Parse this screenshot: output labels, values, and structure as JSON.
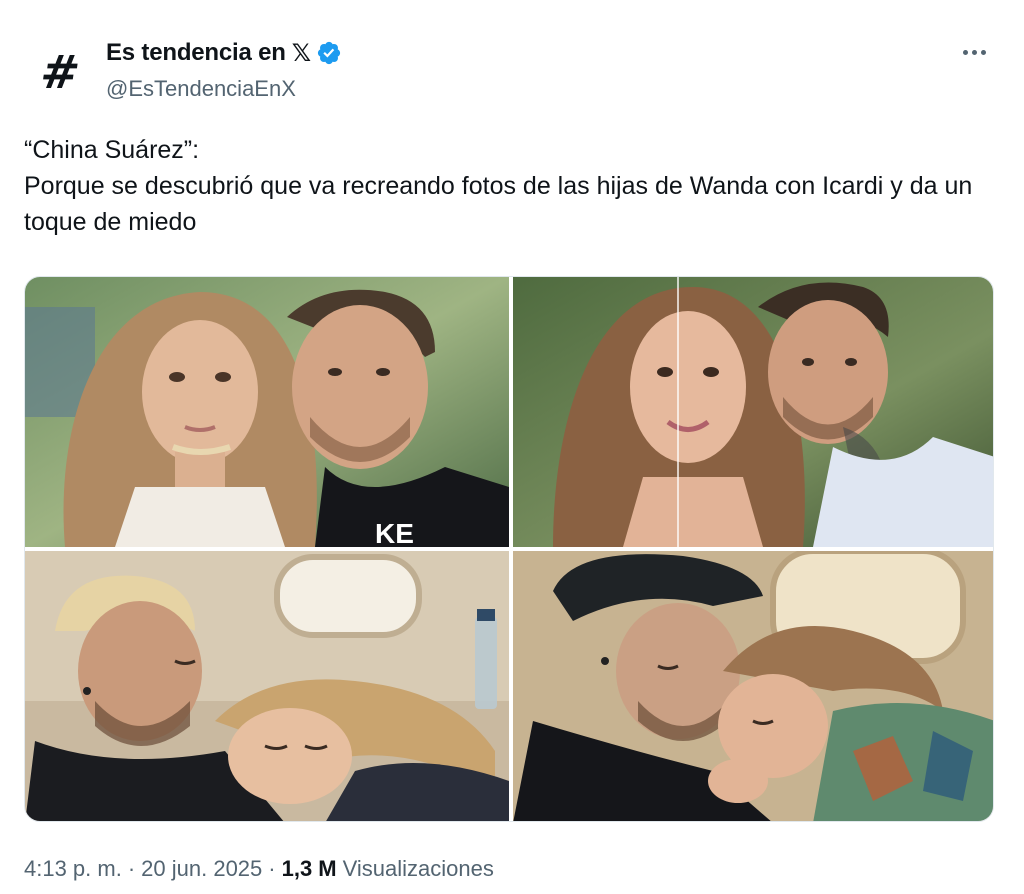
{
  "account": {
    "display_name": "Es tendencia en",
    "x_logo": "𝕏",
    "handle": "@EsTendenciaEnX",
    "avatar_icon": "hashtag-icon",
    "avatar_glyph": "#",
    "verified_icon": "verified-badge-icon",
    "verified_color": "#1d9bf0"
  },
  "tweet": {
    "line1": "“China Suárez”:",
    "line2": "Porque se descubrió que va recreando fotos de las hijas de Wanda con Icardi y da un toque de miedo"
  },
  "media": {
    "photos": [
      {
        "alt": "girl-and-man-selfie-icon"
      },
      {
        "alt": "woman-and-man-selfie-icon"
      },
      {
        "alt": "man-and-girl-sleeping-icon"
      },
      {
        "alt": "man-and-woman-hug-icon"
      }
    ]
  },
  "footer": {
    "time": "4:13 p. m.",
    "date": "20 jun. 2025",
    "views_count": "1,3 M",
    "views_label": "Visualizaciones",
    "separator": "·"
  },
  "colors": {
    "text_primary": "#0f1419",
    "text_secondary": "#536471",
    "border": "#e1e8ed"
  }
}
